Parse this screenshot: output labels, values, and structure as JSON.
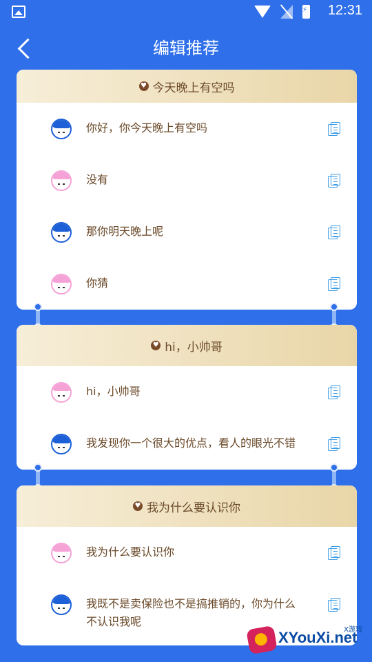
{
  "status_bar": {
    "time": "12:31"
  },
  "header": {
    "title": "编辑推荐"
  },
  "cards": [
    {
      "heading": "今天晚上有空吗",
      "messages": [
        {
          "speaker": "boy",
          "text": "你好，你今天晚上有空吗"
        },
        {
          "speaker": "girl",
          "text": "没有"
        },
        {
          "speaker": "boy",
          "text": "那你明天晚上呢"
        },
        {
          "speaker": "girl",
          "text": "你猜"
        }
      ]
    },
    {
      "heading": "hi，小帅哥",
      "messages": [
        {
          "speaker": "girl",
          "text": "hi，小帅哥"
        },
        {
          "speaker": "boy",
          "text": "我发现你一个很大的优点，看人的眼光不错"
        }
      ]
    },
    {
      "heading": "我为什么要认识你",
      "messages": [
        {
          "speaker": "girl",
          "text": "我为什么要认识你"
        },
        {
          "speaker": "boy",
          "text": "我既不是卖保险也不是搞推销的，你为什么不认识我呢"
        }
      ]
    }
  ],
  "watermark": {
    "brand": "XYouXi.net",
    "small": "X游戏"
  },
  "colors": {
    "background": "#2f6fea",
    "header_gradient_start": "#f7eed9",
    "header_gradient_end": "#e9d6a8",
    "text_brown": "#6b4a2a",
    "copy_icon_blue": "#3a9be6"
  },
  "icons": [
    "gallery-icon",
    "wifi-icon",
    "no-signal-icon",
    "battery-charging-icon",
    "back-icon",
    "heart-icon",
    "boy-avatar-icon",
    "girl-avatar-icon",
    "copy-icon"
  ]
}
